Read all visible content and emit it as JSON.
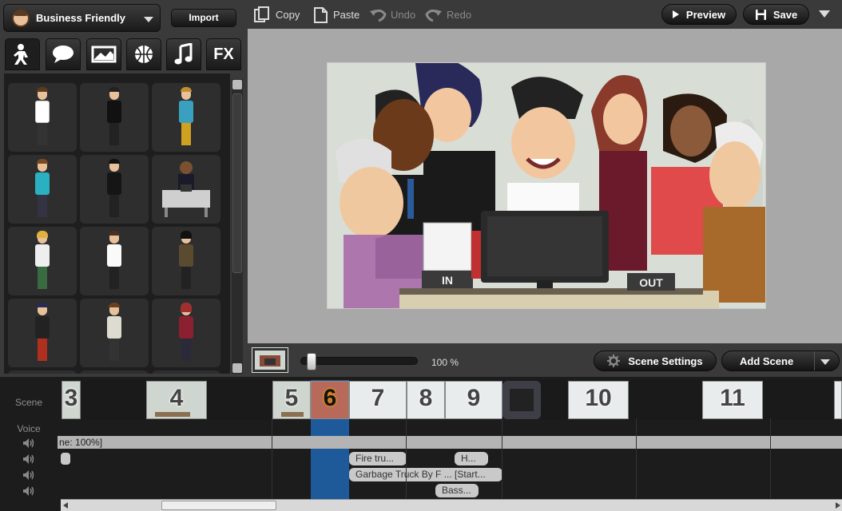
{
  "left_panel": {
    "theme_label": "Business Friendly",
    "import_label": "Import",
    "tabs": [
      "character-icon",
      "speech-bubble-icon",
      "image-icon",
      "ball-icon",
      "music-icon",
      "FX"
    ],
    "fx_label": "FX"
  },
  "toolbar": {
    "copy": "Copy",
    "paste": "Paste",
    "undo": "Undo",
    "redo": "Redo",
    "preview": "Preview",
    "save": "Save"
  },
  "controls": {
    "zoom": "100 %",
    "scene_settings": "Scene Settings",
    "add_scene": "Add Scene"
  },
  "timeline": {
    "scene_label": "Scene",
    "voice_label": "Voice",
    "scenes": [
      {
        "num": "3"
      },
      {
        "num": "4"
      },
      {
        "num": "5"
      },
      {
        "num": "6"
      },
      {
        "num": "7"
      },
      {
        "num": "8"
      },
      {
        "num": "9"
      },
      {
        "num": "10"
      },
      {
        "num": "11"
      }
    ],
    "track_header": "ne: 100%]",
    "chips": [
      "Fire tru...",
      "H...",
      "Garbage Truck By F ... [Start...",
      "Bass..."
    ]
  },
  "colors": {
    "selected_scene": "#1e5a9a",
    "panel_bg": "#3a3a3a",
    "stage_bg": "#a8a8a8"
  }
}
